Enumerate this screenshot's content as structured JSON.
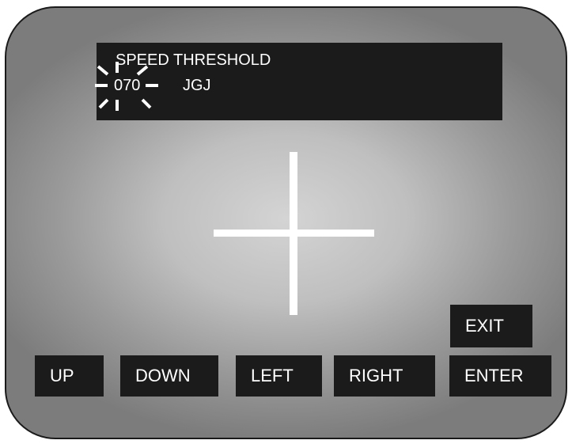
{
  "display": {
    "title": "SPEED THRESHOLD",
    "value": "070",
    "unit": "JGJ",
    "value_state": "blinking"
  },
  "buttons": {
    "up": "UP",
    "down": "DOWN",
    "left": "LEFT",
    "right": "RIGHT",
    "enter": "ENTER",
    "exit": "EXIT"
  },
  "colors": {
    "panel_background": "#1b1b1b",
    "text": "#ffffff",
    "screen_center": "#d4d4d4",
    "screen_edge": "#7c7c7c",
    "screen_border": "#1a1a1a"
  }
}
